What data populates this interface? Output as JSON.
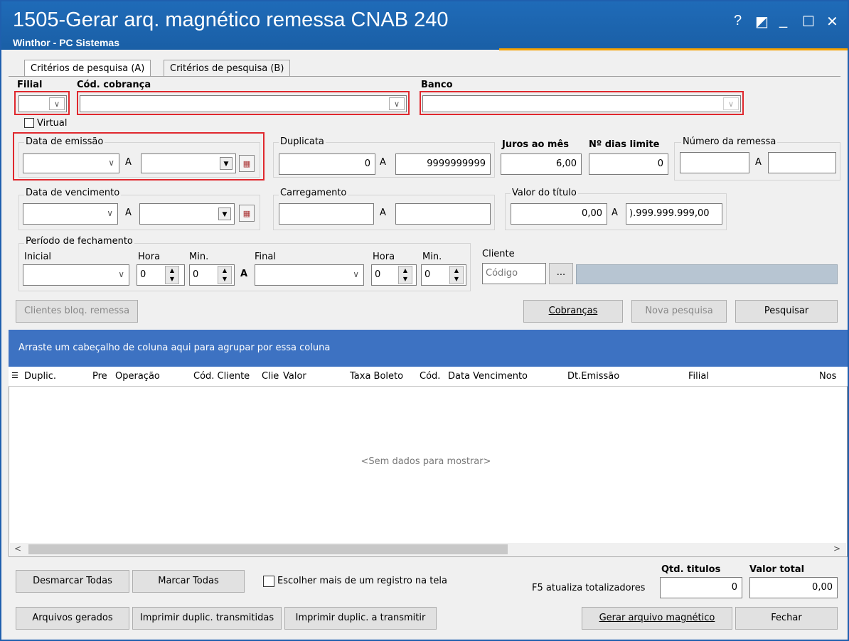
{
  "window": {
    "title": "1505-Gerar arq. magnético remessa CNAB 240",
    "subtitle": "Winthor - PC Sistemas",
    "controls": [
      "?",
      "◩",
      "_",
      "☐",
      "✕"
    ]
  },
  "tabs": [
    {
      "label": "Critérios de pesquisa (A)"
    },
    {
      "label": "Critérios de pesquisa (B)"
    }
  ],
  "filters": {
    "filial_label": "Filial",
    "cod_cobranca_label": "Cód. cobrança",
    "banco_label": "Banco",
    "virtual_label": "Virtual",
    "data_emissao_label": "Data de emissão",
    "a": "A",
    "duplicata_label": "Duplicata",
    "duplicata_from": "0",
    "duplicata_to": "9999999999",
    "juros_label": "Juros ao mês",
    "juros_value": "6,00",
    "dias_limite_label": "Nº dias limite",
    "dias_limite_value": "0",
    "numero_remessa_label": "Número da remessa",
    "data_vencimento_label": "Data de vencimento",
    "carregamento_label": "Carregamento",
    "valor_titulo_label": "Valor do título",
    "valor_from": "0,00",
    "valor_to": ").999.999.999,00",
    "periodo_label": "Período de fechamento",
    "inicial_label": "Inicial",
    "hora_label": "Hora",
    "min_label": "Min.",
    "final_label": "Final",
    "hora_ini": "0",
    "min_ini": "0",
    "hora_fim": "0",
    "min_fim": "0",
    "cliente_label": "Cliente",
    "cliente_placeholder": "Código",
    "ellipsis": "..."
  },
  "buttons": {
    "clientes_bloq": "Clientes bloq. remessa",
    "cobrancas": "Cobranças",
    "nova_pesquisa": "Nova pesquisa",
    "pesquisar": "Pesquisar",
    "desmarcar": "Desmarcar Todas",
    "marcar": "Marcar Todas",
    "arquivos": "Arquivos gerados",
    "imprimir_transmitidas": "Imprimir duplic. transmitidas",
    "imprimir_transmitir": "Imprimir duplic. a transmitir",
    "gerar": "Gerar arquivo magnético",
    "fechar": "Fechar"
  },
  "grid": {
    "group_hint": "Arraste um cabeçalho de coluna aqui para agrupar por essa coluna",
    "columns": [
      "Duplic.",
      "Pre",
      "Operação",
      "Cód. Cliente",
      "Clie",
      "Valor",
      "Taxa Boleto",
      "Cód.",
      "Data Vencimento",
      "Dt.Emissão",
      "Filial",
      "Nos"
    ],
    "empty": "<Sem dados para mostrar>"
  },
  "footer": {
    "escolher_label": "Escolher mais de um registro na tela",
    "qtd_label": "Qtd. titulos",
    "valor_total_label": "Valor total",
    "f5_label": "F5 atualiza totalizadores",
    "qtd_value": "0",
    "valor_total_value": "0,00"
  },
  "colors": {
    "title_bar": "#1f6bb8",
    "grid_group_bar": "#3d72c2",
    "highlight": "#e0282e",
    "accent": "#f7a300"
  }
}
